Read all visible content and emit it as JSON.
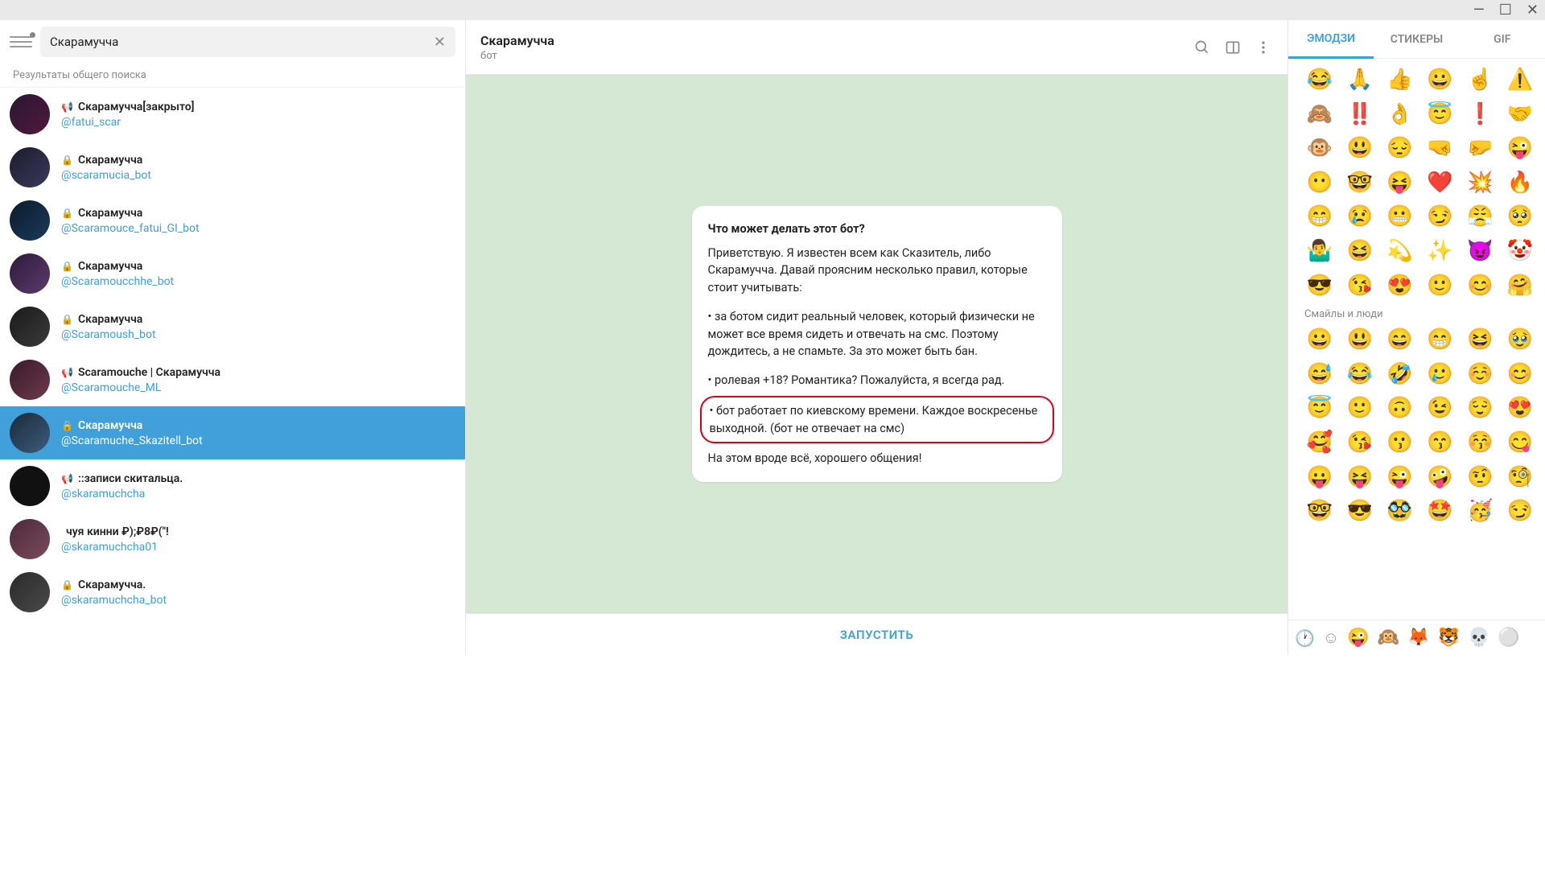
{
  "window": {
    "min": "—",
    "max": "☐",
    "close": "✕"
  },
  "search": {
    "value": "Скарамучча"
  },
  "results_header": "Результаты общего поиска",
  "chats": [
    {
      "icon": "📢",
      "name": "Скарамучча[закрыто]",
      "handle": "@fatui_scar",
      "sel": false
    },
    {
      "icon": "🔒",
      "name": "Скарамучча",
      "handle": "@scaramucia_bot",
      "sel": false
    },
    {
      "icon": "🔒",
      "name": "Скарамучча",
      "handle": "@Scaramouce_fatui_GI_bot",
      "sel": false
    },
    {
      "icon": "🔒",
      "name": "Скарамучча",
      "handle": "@Scaramoucchhe_bot",
      "sel": false
    },
    {
      "icon": "🔒",
      "name": "Скарамучча",
      "handle": "@Scaramoush_bot",
      "sel": false
    },
    {
      "icon": "📢",
      "name": "Scaramouche | Скарамучча",
      "handle": "@Scaramouche_ML",
      "sel": false
    },
    {
      "icon": "🔒",
      "name": "Скарамучча",
      "handle": "@Scaramuche_Skazitell_bot",
      "sel": true
    },
    {
      "icon": "📢",
      "name": "::записи скитальца.",
      "handle": "@skaramuchcha",
      "sel": false
    },
    {
      "icon": "",
      "name": "чуя кинни ₽);₽8₽(\"!",
      "handle": "@skaramuchcha01",
      "sel": false
    },
    {
      "icon": "🔒",
      "name": "Скарамучча.",
      "handle": "@skaramuchcha_bot",
      "sel": false
    }
  ],
  "chat_header": {
    "title": "Скарамучча",
    "sub": "бот"
  },
  "bot_card": {
    "question": "Что может делать этот бот?",
    "intro": "Приветствую. Я известен всем как Сказитель, либо Скарамучча. Давай проясним несколько правил, которые стоит учитывать:",
    "rule1": "• за ботом сидит реальный человек, который физически не может все время сидеть и отвечать на смс. Поэтому дождитесь, а не спамьте. За это может быть бан.",
    "rule2": "• ролевая +18? Романтика? Пожалуйста, я всегда рад.",
    "rule3": "• бот работает по киевскому времени. Каждое воскресенье выходной. (бот не отвечает на смс)",
    "outro": "На этом вроде всё, хорошего общения!"
  },
  "start_button": "ЗАПУСТИТЬ",
  "emoji_tabs": {
    "emoji": "ЭМОДЗИ",
    "stickers": "СТИКЕРЫ",
    "gif": "GIF"
  },
  "emoji_recent": [
    "😂",
    "🙏",
    "👍",
    "😀",
    "☝️",
    "⚠️",
    "🙈",
    "‼️",
    "👌",
    "😇",
    "❗",
    "🤝",
    "🐵",
    "😃",
    "😔",
    "🤜",
    "🤛",
    "😜",
    "😶",
    "🤓",
    "😝",
    "❤️",
    "💥",
    "🔥",
    "😁",
    "😢",
    "😬",
    "😏",
    "😤",
    "🥺",
    "🤷‍♂️",
    "😆",
    "💫",
    "✨",
    "😈",
    "🤡",
    "😎",
    "😘",
    "😍",
    "🙂",
    "😊",
    "🤗"
  ],
  "emoji_section": "Смайлы и люди",
  "emoji_people": [
    "😀",
    "😃",
    "😄",
    "😁",
    "😆",
    "🥹",
    "😅",
    "😂",
    "🤣",
    "🥲",
    "☺️",
    "😊",
    "😇",
    "🙂",
    "🙃",
    "😉",
    "😌",
    "😍",
    "🥰",
    "😘",
    "😗",
    "😙",
    "😚",
    "😋",
    "😛",
    "😝",
    "😜",
    "🤪",
    "🤨",
    "🧐",
    "🤓",
    "😎",
    "🥸",
    "🤩",
    "🥳",
    "😏"
  ],
  "emoji_footer": [
    "🕐",
    "☺",
    "😜",
    "🙉",
    "🦊",
    "🐯",
    "💀",
    "⚪"
  ]
}
